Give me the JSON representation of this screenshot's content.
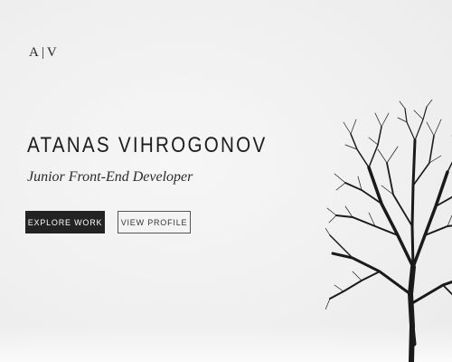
{
  "header": {
    "logo_text": "A|V"
  },
  "hero": {
    "name": "ATANAS VIHROGONOV",
    "subtitle": "Junior Front-End Developer",
    "primary_button_label": "EXPLORE WORK",
    "secondary_button_label": "VIEW PROFILE",
    "background_image": "bare-tree-winter-icon"
  },
  "colors": {
    "background": "#f1f1f1",
    "text": "#1d1d1d",
    "primary_button_bg": "#232323",
    "primary_button_text": "#ffffff",
    "secondary_button_border": "#555555"
  }
}
